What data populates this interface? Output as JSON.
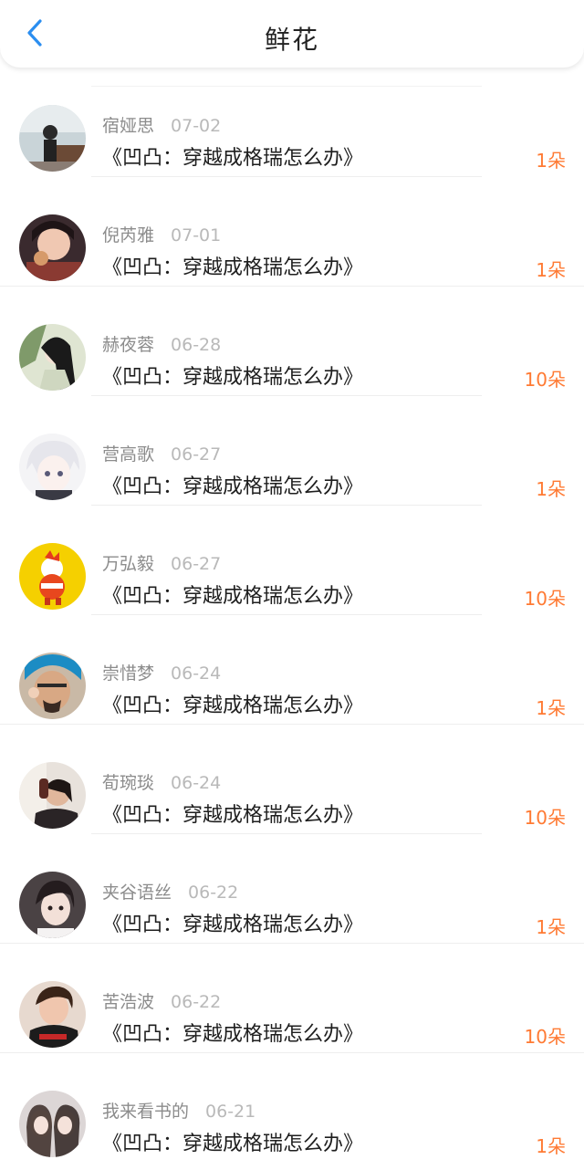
{
  "header": {
    "title": "鲜花",
    "back_icon": "chevron-left-icon",
    "accent_color": "#2b8ef0"
  },
  "colors": {
    "count": "#ff7a33",
    "name": "#8c8c8c",
    "date": "#b9b9b9"
  },
  "items": [
    {
      "name": "宿娅思",
      "date": "07-02",
      "book": "《凹凸：穿越成格瑞怎么办》",
      "count": "1朵"
    },
    {
      "name": "倪芮雅",
      "date": "07-01",
      "book": "《凹凸：穿越成格瑞怎么办》",
      "count": "1朵"
    },
    {
      "name": "赫夜蓉",
      "date": "06-28",
      "book": "《凹凸：穿越成格瑞怎么办》",
      "count": "10朵"
    },
    {
      "name": "营高歌",
      "date": "06-27",
      "book": "《凹凸：穿越成格瑞怎么办》",
      "count": "1朵"
    },
    {
      "name": "万弘毅",
      "date": "06-27",
      "book": "《凹凸：穿越成格瑞怎么办》",
      "count": "10朵"
    },
    {
      "name": "崇惜梦",
      "date": "06-24",
      "book": "《凹凸：穿越成格瑞怎么办》",
      "count": "1朵"
    },
    {
      "name": "荀琬琰",
      "date": "06-24",
      "book": "《凹凸：穿越成格瑞怎么办》",
      "count": "10朵"
    },
    {
      "name": "夹谷语丝",
      "date": "06-22",
      "book": "《凹凸：穿越成格瑞怎么办》",
      "count": "1朵"
    },
    {
      "name": "苦浩波",
      "date": "06-22",
      "book": "《凹凸：穿越成格瑞怎么办》",
      "count": "10朵"
    },
    {
      "name": "我来看书的",
      "date": "06-21",
      "book": "《凹凸：穿越成格瑞怎么办》",
      "count": "1朵"
    }
  ]
}
